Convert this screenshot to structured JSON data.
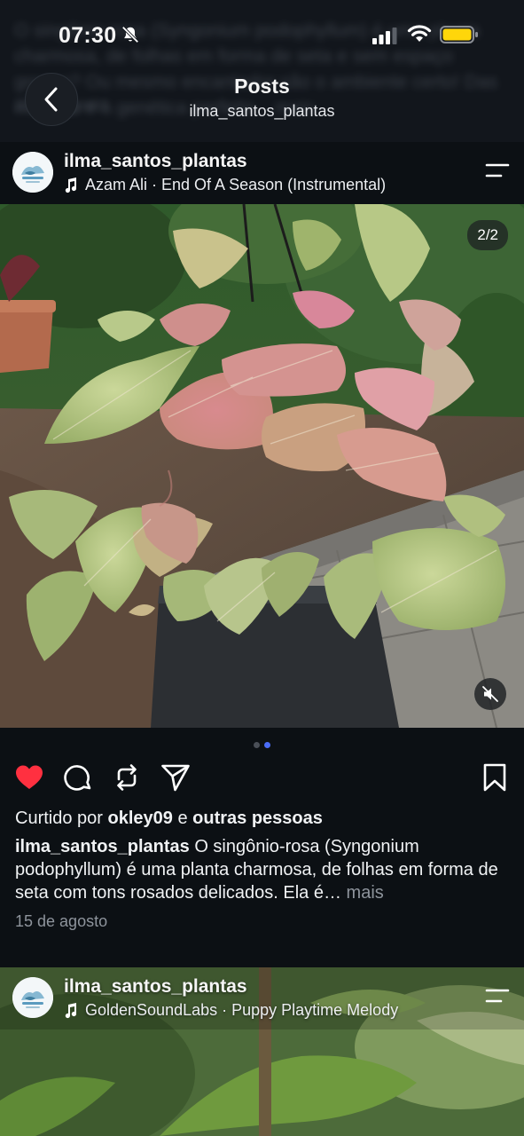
{
  "background_caption": {
    "text": "O singônio-rosa (Syngonium podophyllum) é uma planta charmosa, de folhas em forma de seta e sem espaço grosso? Ou mesmo encantador são o ambiente certo! Das manhãs e à genética perfeita... mais",
    "date": "15 de agosto"
  },
  "status_bar": {
    "time": "07:30",
    "icons": [
      "bell-slash-icon",
      "signal-icon",
      "wifi-icon",
      "battery-icon"
    ],
    "battery_color": "#ffd60a"
  },
  "nav": {
    "title": "Posts",
    "subtitle": "ilma_santos_plantas"
  },
  "post1": {
    "username": "ilma_santos_plantas",
    "music": "Azam Ali · End Of A Season (Instrumental)",
    "counter": "2/2",
    "carousel": {
      "total": 2,
      "active": 2
    },
    "liked": true,
    "like_color": "#ff3040",
    "likes_prefix": "Curtido por",
    "likes_user": "okley09",
    "likes_conj": "e",
    "likes_others": "outras pessoas",
    "caption_user": "ilma_santos_plantas",
    "caption_text": "O singônio-rosa (Syngonium podophyllum) é uma planta charmosa, de folhas em forma de seta com tons rosados delicados. Ela é…",
    "caption_more": "mais",
    "date": "15 de agosto"
  },
  "post2": {
    "username": "ilma_santos_plantas",
    "music": "GoldenSoundLabs · Puppy Playtime Melody"
  }
}
